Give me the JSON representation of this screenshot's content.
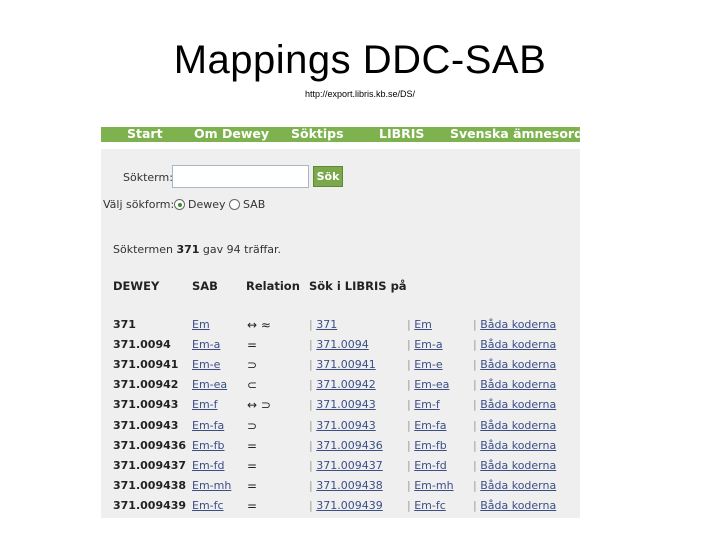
{
  "slide": {
    "title": "Mappings DDC-SAB",
    "subtitle": "http://export.libris.kb.se/DS/"
  },
  "colors": {
    "nav_bg": "#7db24f",
    "panel_bg": "#efefef",
    "link": "#3b4f86",
    "button_bg": "#7aa84a"
  },
  "nav": {
    "items": [
      {
        "label": "Start"
      },
      {
        "label": "Om Dewey"
      },
      {
        "label": "Söktips"
      },
      {
        "label": "LIBRIS"
      },
      {
        "label": "Svenska ämnesord"
      }
    ]
  },
  "search": {
    "label": "Sökterm:",
    "value": "",
    "placeholder": "",
    "button_label": "Sök"
  },
  "search_form": {
    "label": "Välj sökform:",
    "options": [
      {
        "label": "Dewey",
        "checked": true
      },
      {
        "label": "SAB",
        "checked": false
      }
    ]
  },
  "result_info": {
    "prefix": "Söktermen",
    "term": "371",
    "suffix": "gav 94 träffar."
  },
  "table": {
    "headers": [
      "DEWEY",
      "SAB",
      "Relation",
      "Sök i LIBRIS på"
    ],
    "rows": [
      {
        "dewey": "371",
        "sab": "Em",
        "relation": "↔ ≈",
        "libris_dewey": "371",
        "libris_sab": "Em",
        "libris_both": "Båda koderna"
      },
      {
        "dewey": "371.0094",
        "sab": "Em-a",
        "relation": "=",
        "libris_dewey": "371.0094",
        "libris_sab": "Em-a",
        "libris_both": "Båda koderna"
      },
      {
        "dewey": "371.00941",
        "sab": "Em-e",
        "relation": "⊃",
        "libris_dewey": "371.00941",
        "libris_sab": "Em-e",
        "libris_both": "Båda koderna"
      },
      {
        "dewey": "371.00942",
        "sab": "Em-ea",
        "relation": "⊂",
        "libris_dewey": "371.00942",
        "libris_sab": "Em-ea",
        "libris_both": "Båda koderna"
      },
      {
        "dewey": "371.00943",
        "sab": "Em-f",
        "relation": "↔ ⊃",
        "libris_dewey": "371.00943",
        "libris_sab": "Em-f",
        "libris_both": "Båda koderna"
      },
      {
        "dewey": "371.00943",
        "sab": "Em-fa",
        "relation": "⊃",
        "libris_dewey": "371.00943",
        "libris_sab": "Em-fa",
        "libris_both": "Båda koderna"
      },
      {
        "dewey": "371.009436",
        "sab": "Em-fb",
        "relation": "=",
        "libris_dewey": "371.009436",
        "libris_sab": "Em-fb",
        "libris_both": "Båda koderna"
      },
      {
        "dewey": "371.009437",
        "sab": "Em-fd",
        "relation": "=",
        "libris_dewey": "371.009437",
        "libris_sab": "Em-fd",
        "libris_both": "Båda koderna"
      },
      {
        "dewey": "371.009438",
        "sab": "Em-mh",
        "relation": "=",
        "libris_dewey": "371.009438",
        "libris_sab": "Em-mh",
        "libris_both": "Båda koderna"
      },
      {
        "dewey": "371.009439",
        "sab": "Em-fc",
        "relation": "=",
        "libris_dewey": "371.009439",
        "libris_sab": "Em-fc",
        "libris_both": "Båda koderna"
      }
    ],
    "separator": "|"
  }
}
